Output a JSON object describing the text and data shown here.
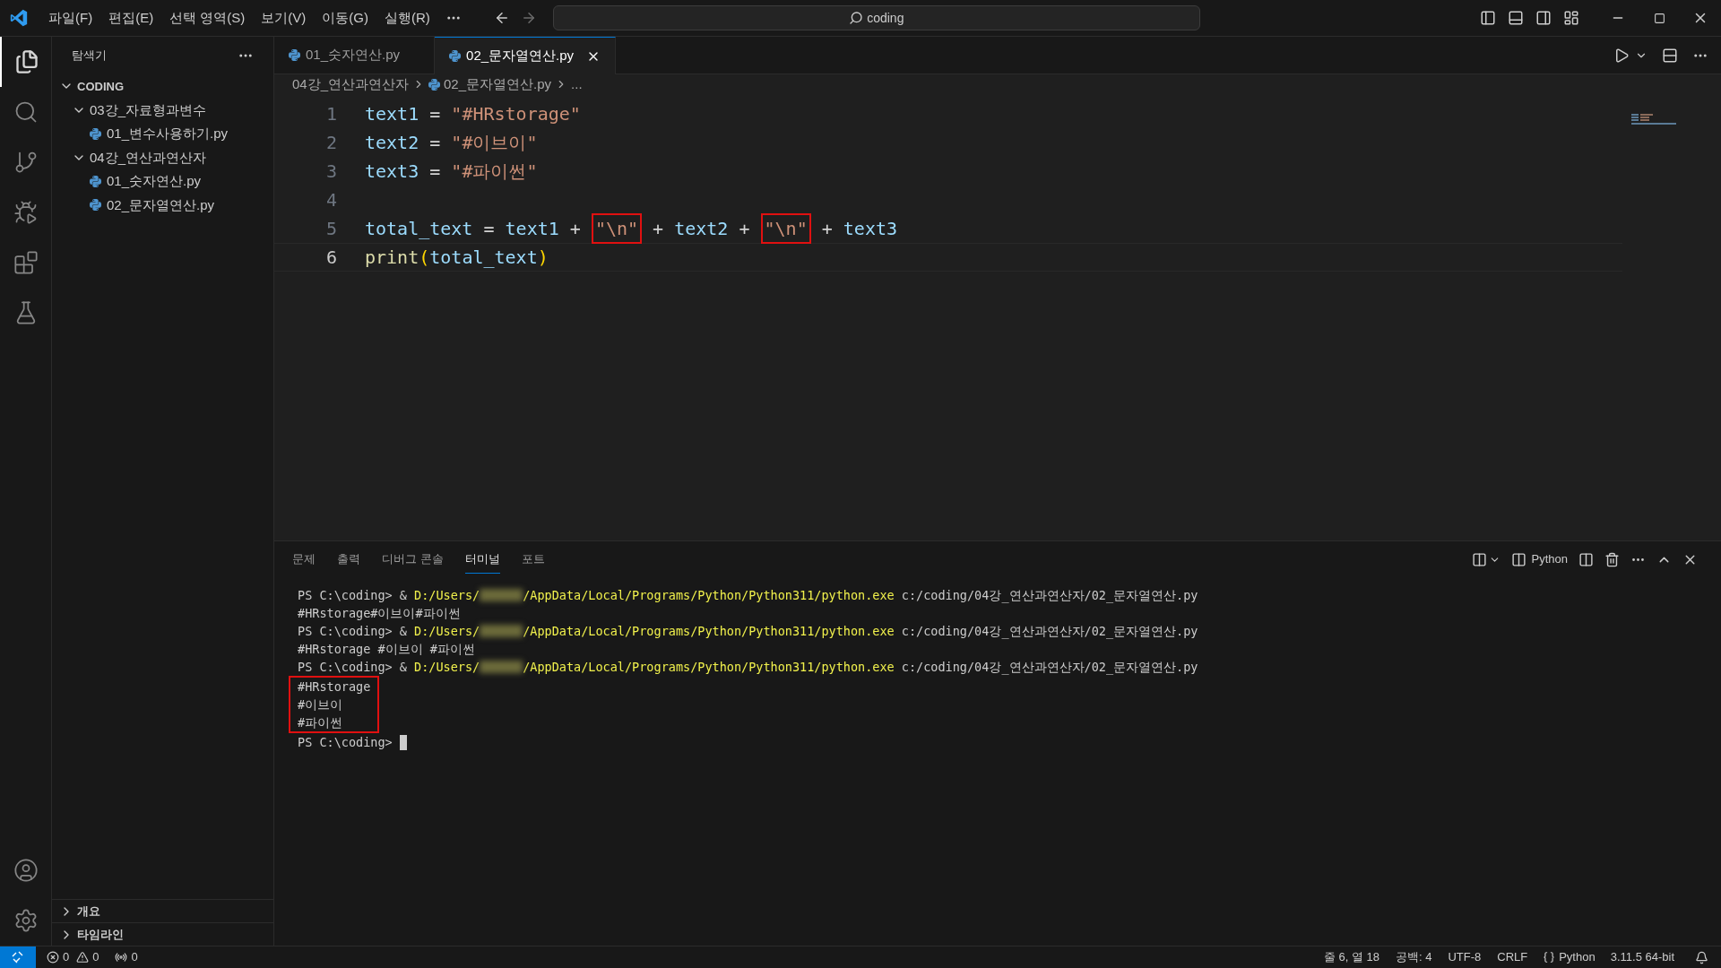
{
  "title_bar": {
    "menus": [
      "파일(F)",
      "편집(E)",
      "선택 영역(S)",
      "보기(V)",
      "이동(G)",
      "실행(R)"
    ],
    "search": {
      "value": "coding"
    }
  },
  "explorer": {
    "title": "탐색기",
    "tree": [
      {
        "label": "CODING",
        "kind": "root",
        "expanded": true,
        "children": [
          {
            "label": "03강_자료형과변수",
            "kind": "folder",
            "expanded": true,
            "children": [
              {
                "label": "01_변수사용하기.py",
                "kind": "file"
              }
            ]
          },
          {
            "label": "04강_연산과연산자",
            "kind": "folder",
            "expanded": true,
            "children": [
              {
                "label": "01_숫자연산.py",
                "kind": "file"
              },
              {
                "label": "02_문자열연산.py",
                "kind": "file"
              }
            ]
          }
        ]
      }
    ],
    "sections": [
      {
        "label": "개요",
        "expanded": false
      },
      {
        "label": "타임라인",
        "expanded": false
      }
    ]
  },
  "editor": {
    "tabs": [
      {
        "label": "01_숫자연산.py",
        "selected": false
      },
      {
        "label": "02_문자열연산.py",
        "selected": true
      }
    ],
    "breadcrumb": [
      {
        "kind": "folder",
        "label": "04강_연산과연산자"
      },
      {
        "kind": "file",
        "label": "02_문자열연산.py"
      },
      {
        "kind": "more",
        "label": "..."
      }
    ],
    "lines": [
      {
        "number": "1",
        "current": false,
        "tokens": [
          {
            "text": "text1",
            "kind": "variable",
            "highlighted": false
          },
          {
            "text": " = ",
            "kind": "operator",
            "highlighted": false
          },
          {
            "text": "\"#HRstorage\"",
            "kind": "string",
            "highlighted": false
          }
        ]
      },
      {
        "number": "2",
        "current": false,
        "tokens": [
          {
            "text": "text2",
            "kind": "variable",
            "highlighted": false
          },
          {
            "text": " = ",
            "kind": "operator",
            "highlighted": false
          },
          {
            "text": "\"#이브이\"",
            "kind": "string",
            "highlighted": false
          }
        ]
      },
      {
        "number": "3",
        "current": false,
        "tokens": [
          {
            "text": "text3",
            "kind": "variable",
            "highlighted": false
          },
          {
            "text": " = ",
            "kind": "operator",
            "highlighted": false
          },
          {
            "text": "\"#파이썬\"",
            "kind": "string",
            "highlighted": false
          }
        ]
      },
      {
        "number": "4",
        "current": false
      },
      {
        "number": "5",
        "current": false,
        "tokens": [
          {
            "text": "total_text",
            "kind": "variable",
            "highlighted": false
          },
          {
            "text": " = ",
            "kind": "operator",
            "highlighted": false
          },
          {
            "text": "text1",
            "kind": "variable",
            "highlighted": false
          },
          {
            "text": " + ",
            "kind": "operator",
            "highlighted": false
          },
          {
            "text": "\"\\n\"",
            "kind": "string",
            "highlighted": true
          },
          {
            "text": " + ",
            "kind": "operator",
            "highlighted": false
          },
          {
            "text": "text2",
            "kind": "variable",
            "highlighted": false
          },
          {
            "text": " + ",
            "kind": "operator",
            "highlighted": false
          },
          {
            "text": "\"\\n\"",
            "kind": "string",
            "highlighted": true
          },
          {
            "text": " + ",
            "kind": "operator",
            "highlighted": false
          },
          {
            "text": "text3",
            "kind": "variable",
            "highlighted": false
          }
        ]
      },
      {
        "number": "6",
        "current": true,
        "tokens": [
          {
            "text": "print",
            "kind": "function",
            "highlighted": false
          },
          {
            "text": "(",
            "kind": "bracket",
            "highlighted": false
          },
          {
            "text": "total_text",
            "kind": "variable",
            "highlighted": false
          },
          {
            "text": ")",
            "kind": "bracket",
            "highlighted": false
          }
        ]
      }
    ]
  },
  "panel": {
    "tabs": [
      {
        "label": "문제",
        "selected": false
      },
      {
        "label": "출력",
        "selected": false
      },
      {
        "label": "디버그 콘솔",
        "selected": false
      },
      {
        "label": "터미널",
        "selected": true
      },
      {
        "label": "포트",
        "selected": false
      }
    ],
    "profile": "Python",
    "terminal": [
      {
        "kind": "command",
        "segments": [
          {
            "kind": "prompt",
            "text": "PS C:\\coding> & "
          },
          {
            "kind": "path",
            "text": "D:/Users/"
          },
          {
            "kind": "redacted"
          },
          {
            "kind": "path",
            "text": "/AppData/Local/Programs/Python/Python311/python.exe"
          },
          {
            "kind": "prompt",
            "text": " c:/coding/04강_연산과연산자/02_문자열연산.py"
          }
        ]
      },
      {
        "kind": "output",
        "text": "#HRstorage#이브이#파이썬"
      },
      {
        "kind": "command",
        "segments": [
          {
            "kind": "prompt",
            "text": "PS C:\\coding> & "
          },
          {
            "kind": "path",
            "text": "D:/Users/"
          },
          {
            "kind": "redacted"
          },
          {
            "kind": "path",
            "text": "/AppData/Local/Programs/Python/Python311/python.exe"
          },
          {
            "kind": "prompt",
            "text": " c:/coding/04강_연산과연산자/02_문자열연산.py"
          }
        ]
      },
      {
        "kind": "output",
        "text": "#HRstorage #이브이 #파이썬"
      },
      {
        "kind": "command",
        "segments": [
          {
            "kind": "prompt",
            "text": "PS C:\\coding> & "
          },
          {
            "kind": "path",
            "text": "D:/Users/"
          },
          {
            "kind": "redacted"
          },
          {
            "kind": "path",
            "text": "/AppData/Local/Programs/Python/Python311/python.exe"
          },
          {
            "kind": "prompt",
            "text": " c:/coding/04강_연산과연산자/02_문자열연산.py"
          }
        ]
      },
      {
        "kind": "highlight_box",
        "lines": [
          {
            "kind": "output",
            "text": "#HRstorage"
          },
          {
            "kind": "output",
            "text": "#이브이"
          },
          {
            "kind": "output",
            "text": "#파이썬"
          }
        ]
      },
      {
        "kind": "prompt",
        "text": "PS C:\\coding> ",
        "cursor": true
      }
    ]
  },
  "status_bar": {
    "errors": "0",
    "warnings": "0",
    "ports": "0",
    "items": [
      {
        "kind": "text",
        "text": "줄 6, 열 18"
      },
      {
        "kind": "text",
        "text": "공백: 4"
      },
      {
        "kind": "text",
        "text": "UTF-8"
      },
      {
        "kind": "text",
        "text": "CRLF"
      },
      {
        "kind": "language",
        "text": "Python"
      },
      {
        "kind": "text",
        "text": "3.11.5 64-bit"
      }
    ]
  }
}
